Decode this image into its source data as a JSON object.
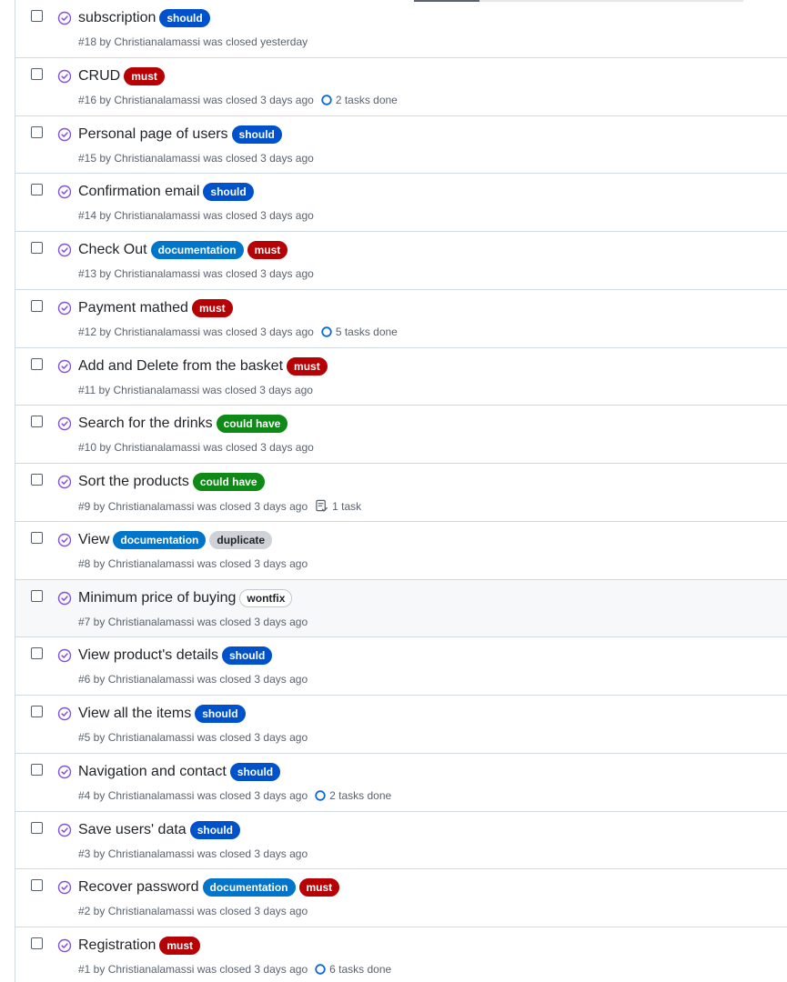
{
  "colors": {
    "should": "#0052cc",
    "must": "#b60205",
    "documentation": "#0075ca",
    "could_have": "#0e8a16",
    "duplicate": "#cfd3d7",
    "wontfix": "#ffffff",
    "closed_icon": "#8250df",
    "progress_icon": "#0969da"
  },
  "issues": [
    {
      "title": "subscription",
      "labels": [
        {
          "text": "should",
          "kind": "should"
        }
      ],
      "meta": "#18 by Christianalamassi was closed yesterday",
      "tasks": "",
      "task_icon": ""
    },
    {
      "title": "CRUD",
      "labels": [
        {
          "text": "must",
          "kind": "must"
        }
      ],
      "meta": "#16 by Christianalamassi was closed 3 days ago",
      "tasks": "2 tasks done",
      "task_icon": "progress-circle-icon"
    },
    {
      "title": "Personal page of users",
      "labels": [
        {
          "text": "should",
          "kind": "should"
        }
      ],
      "meta": "#15 by Christianalamassi was closed 3 days ago",
      "tasks": "",
      "task_icon": ""
    },
    {
      "title": "Confirmation email",
      "labels": [
        {
          "text": "should",
          "kind": "should"
        }
      ],
      "meta": "#14 by Christianalamassi was closed 3 days ago",
      "tasks": "",
      "task_icon": ""
    },
    {
      "title": "Check Out",
      "labels": [
        {
          "text": "documentation",
          "kind": "documentation"
        },
        {
          "text": "must",
          "kind": "must"
        }
      ],
      "meta": "#13 by Christianalamassi was closed 3 days ago",
      "tasks": "",
      "task_icon": ""
    },
    {
      "title": "Payment mathed",
      "labels": [
        {
          "text": "must",
          "kind": "must"
        }
      ],
      "meta": "#12 by Christianalamassi was closed 3 days ago",
      "tasks": "5 tasks done",
      "task_icon": "progress-circle-icon"
    },
    {
      "title": "Add and Delete from the basket",
      "labels": [
        {
          "text": "must",
          "kind": "must"
        }
      ],
      "meta": "#11 by Christianalamassi was closed 3 days ago",
      "tasks": "",
      "task_icon": ""
    },
    {
      "title": "Search for the drinks",
      "labels": [
        {
          "text": "could have",
          "kind": "could_have"
        }
      ],
      "meta": "#10 by Christianalamassi was closed 3 days ago",
      "tasks": "",
      "task_icon": ""
    },
    {
      "title": "Sort the products",
      "labels": [
        {
          "text": "could have",
          "kind": "could_have"
        }
      ],
      "meta": "#9 by Christianalamassi was closed 3 days ago",
      "tasks": "1 task",
      "task_icon": "tasklist-icon"
    },
    {
      "title": "View",
      "labels": [
        {
          "text": "documentation",
          "kind": "documentation"
        },
        {
          "text": "duplicate",
          "kind": "duplicate"
        }
      ],
      "meta": "#8 by Christianalamassi was closed 3 days ago",
      "tasks": "",
      "task_icon": ""
    },
    {
      "title": "Minimum price of buying",
      "labels": [
        {
          "text": "wontfix",
          "kind": "wontfix"
        }
      ],
      "meta": "#7 by Christianalamassi was closed 3 days ago",
      "tasks": "",
      "task_icon": "",
      "hovered": true
    },
    {
      "title": "View product's details",
      "labels": [
        {
          "text": "should",
          "kind": "should"
        }
      ],
      "meta": "#6 by Christianalamassi was closed 3 days ago",
      "tasks": "",
      "task_icon": ""
    },
    {
      "title": "View all the items",
      "labels": [
        {
          "text": "should",
          "kind": "should"
        }
      ],
      "meta": "#5 by Christianalamassi was closed 3 days ago",
      "tasks": "",
      "task_icon": ""
    },
    {
      "title": "Navigation and contact",
      "labels": [
        {
          "text": "should",
          "kind": "should"
        }
      ],
      "meta": "#4 by Christianalamassi was closed 3 days ago",
      "tasks": "2 tasks done",
      "task_icon": "progress-circle-icon"
    },
    {
      "title": "Save users' data",
      "labels": [
        {
          "text": "should",
          "kind": "should"
        }
      ],
      "meta": "#3 by Christianalamassi was closed 3 days ago",
      "tasks": "",
      "task_icon": ""
    },
    {
      "title": "Recover password",
      "labels": [
        {
          "text": "documentation",
          "kind": "documentation"
        },
        {
          "text": "must",
          "kind": "must"
        }
      ],
      "meta": "#2 by Christianalamassi was closed 3 days ago",
      "tasks": "",
      "task_icon": ""
    },
    {
      "title": "Registration",
      "labels": [
        {
          "text": "must",
          "kind": "must"
        }
      ],
      "meta": "#1 by Christianalamassi was closed 3 days ago",
      "tasks": "6 tasks done",
      "task_icon": "progress-circle-icon"
    }
  ]
}
